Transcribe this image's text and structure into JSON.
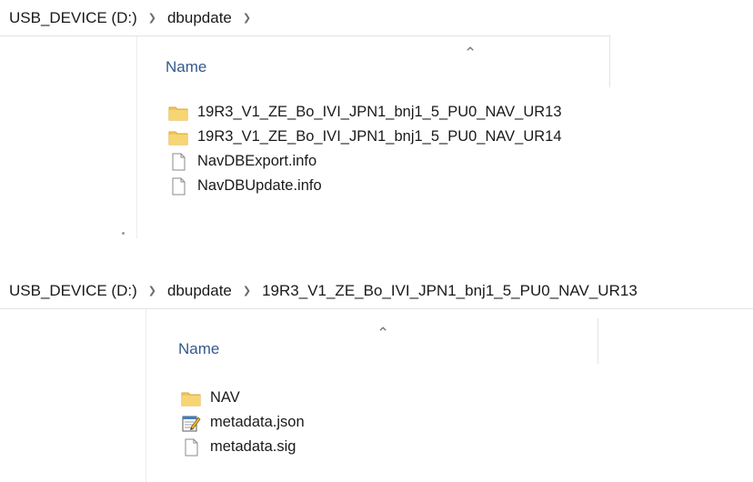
{
  "panel1": {
    "breadcrumb": [
      "USB_DEVICE (D:)",
      "dbupdate"
    ],
    "column_header": "Name",
    "items": [
      {
        "name": "19R3_V1_ZE_Bo_IVI_JPN1_bnj1_5_PU0_NAV_UR13",
        "icon": "folder-icon"
      },
      {
        "name": "19R3_V1_ZE_Bo_IVI_JPN1_bnj1_5_PU0_NAV_UR14",
        "icon": "folder-icon"
      },
      {
        "name": "NavDBExport.info",
        "icon": "file-icon"
      },
      {
        "name": "NavDBUpdate.info",
        "icon": "file-icon"
      }
    ]
  },
  "panel2": {
    "breadcrumb": [
      "USB_DEVICE (D:)",
      "dbupdate",
      "19R3_V1_ZE_Bo_IVI_JPN1_bnj1_5_PU0_NAV_UR13"
    ],
    "column_header": "Name",
    "items": [
      {
        "name": "NAV",
        "icon": "folder-icon"
      },
      {
        "name": "metadata.json",
        "icon": "notepad-file-icon"
      },
      {
        "name": "metadata.sig",
        "icon": "file-icon"
      }
    ]
  },
  "icons": {
    "separator": "chevron-right-icon",
    "sort_indicator": "caret-up-icon"
  },
  "colors": {
    "folder": "#f2c65a",
    "folder_dark": "#dba838",
    "header_text": "#335a8c",
    "separator": "#6b6b6b"
  }
}
